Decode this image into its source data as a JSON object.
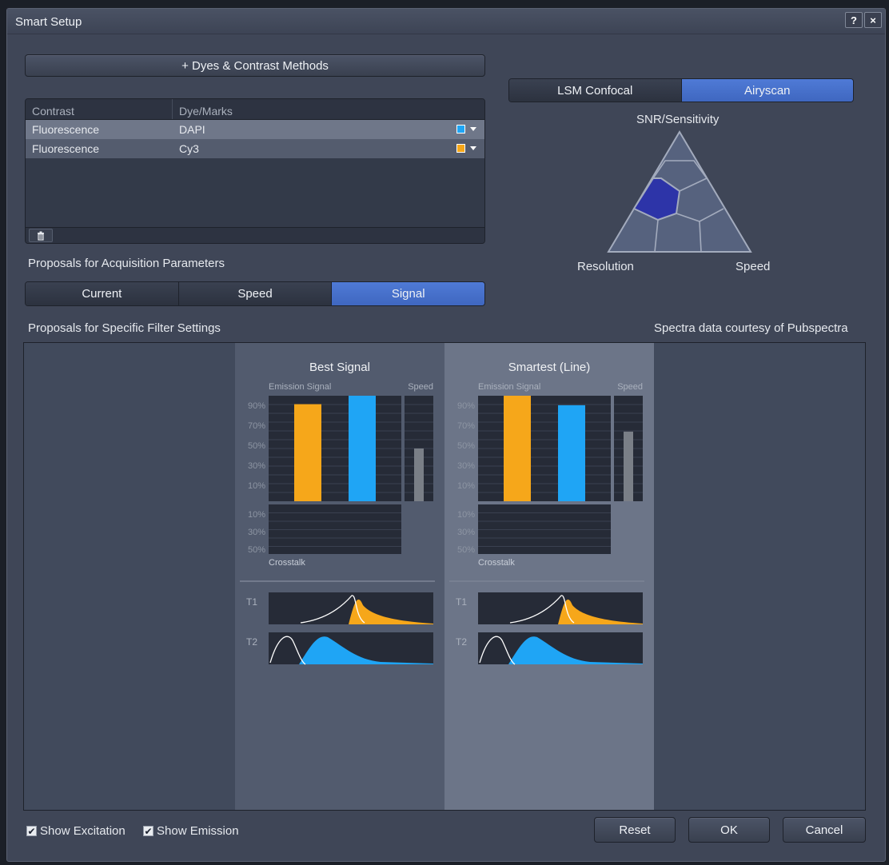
{
  "window": {
    "title": "Smart Setup",
    "help_label": "?",
    "close_label": "×"
  },
  "dyes_button": "+ Dyes & Contrast Methods",
  "table": {
    "headers": [
      "Contrast",
      "Dye/Marks"
    ],
    "rows": [
      {
        "contrast": "Fluorescence",
        "dye": "DAPI",
        "color": "#1fa5f5"
      },
      {
        "contrast": "Fluorescence",
        "dye": "Cy3",
        "color": "#f6a71a"
      }
    ]
  },
  "proposals_acq": {
    "label": "Proposals for Acquisition Parameters",
    "tabs": [
      "Current",
      "Speed",
      "Signal"
    ],
    "active": "Signal"
  },
  "mode_tabs": {
    "items": [
      "LSM Confocal",
      "Airyscan"
    ],
    "active": "Airyscan"
  },
  "triangle": {
    "top": "SNR/Sensitivity",
    "left": "Resolution",
    "right": "Speed"
  },
  "filter_label": "Proposals for Specific Filter Settings",
  "courtesy": "Spectra data courtesy of Pubspectra",
  "columns": [
    {
      "title": "Best Signal",
      "emission_label": "Emission Signal",
      "speed_label": "Speed",
      "crosstalk_label": "Crosstalk",
      "emission_values": [
        {
          "dye": "Cy3",
          "value": 92
        },
        {
          "dye": "DAPI",
          "value": 100
        }
      ],
      "speed_value": 50
    },
    {
      "title": "Smartest (Line)",
      "emission_label": "Emission Signal",
      "speed_label": "Speed",
      "crosstalk_label": "Crosstalk",
      "emission_values": [
        {
          "dye": "Cy3",
          "value": 100
        },
        {
          "dye": "DAPI",
          "value": 91
        }
      ],
      "speed_value": 66
    }
  ],
  "y_ticks_emission": [
    "90%",
    "70%",
    "50%",
    "30%",
    "10%"
  ],
  "y_ticks_crosstalk": [
    "10%",
    "30%",
    "50%"
  ],
  "tracks": [
    "T1",
    "T2"
  ],
  "footer": {
    "show_excitation": "Show Excitation",
    "show_emission": "Show Emission",
    "reset": "Reset",
    "ok": "OK",
    "cancel": "Cancel"
  },
  "colors": {
    "accent": "#4a73d0",
    "cy3": "#f6a71a",
    "dapi": "#1fa5f5",
    "triangle_selected": "#2d34a8"
  }
}
